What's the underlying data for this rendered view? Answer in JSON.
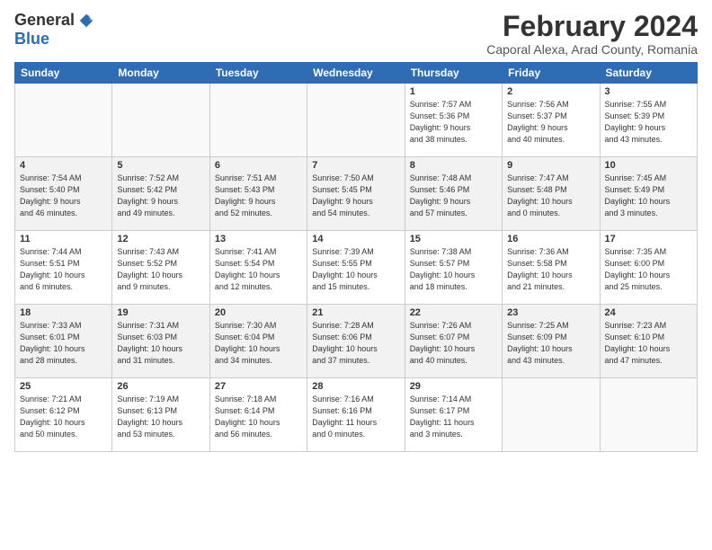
{
  "logo": {
    "general": "General",
    "blue": "Blue"
  },
  "title": "February 2024",
  "subtitle": "Caporal Alexa, Arad County, Romania",
  "headers": [
    "Sunday",
    "Monday",
    "Tuesday",
    "Wednesday",
    "Thursday",
    "Friday",
    "Saturday"
  ],
  "weeks": [
    [
      {
        "day": "",
        "info": ""
      },
      {
        "day": "",
        "info": ""
      },
      {
        "day": "",
        "info": ""
      },
      {
        "day": "",
        "info": ""
      },
      {
        "day": "1",
        "info": "Sunrise: 7:57 AM\nSunset: 5:36 PM\nDaylight: 9 hours\nand 38 minutes."
      },
      {
        "day": "2",
        "info": "Sunrise: 7:56 AM\nSunset: 5:37 PM\nDaylight: 9 hours\nand 40 minutes."
      },
      {
        "day": "3",
        "info": "Sunrise: 7:55 AM\nSunset: 5:39 PM\nDaylight: 9 hours\nand 43 minutes."
      }
    ],
    [
      {
        "day": "4",
        "info": "Sunrise: 7:54 AM\nSunset: 5:40 PM\nDaylight: 9 hours\nand 46 minutes."
      },
      {
        "day": "5",
        "info": "Sunrise: 7:52 AM\nSunset: 5:42 PM\nDaylight: 9 hours\nand 49 minutes."
      },
      {
        "day": "6",
        "info": "Sunrise: 7:51 AM\nSunset: 5:43 PM\nDaylight: 9 hours\nand 52 minutes."
      },
      {
        "day": "7",
        "info": "Sunrise: 7:50 AM\nSunset: 5:45 PM\nDaylight: 9 hours\nand 54 minutes."
      },
      {
        "day": "8",
        "info": "Sunrise: 7:48 AM\nSunset: 5:46 PM\nDaylight: 9 hours\nand 57 minutes."
      },
      {
        "day": "9",
        "info": "Sunrise: 7:47 AM\nSunset: 5:48 PM\nDaylight: 10 hours\nand 0 minutes."
      },
      {
        "day": "10",
        "info": "Sunrise: 7:45 AM\nSunset: 5:49 PM\nDaylight: 10 hours\nand 3 minutes."
      }
    ],
    [
      {
        "day": "11",
        "info": "Sunrise: 7:44 AM\nSunset: 5:51 PM\nDaylight: 10 hours\nand 6 minutes."
      },
      {
        "day": "12",
        "info": "Sunrise: 7:43 AM\nSunset: 5:52 PM\nDaylight: 10 hours\nand 9 minutes."
      },
      {
        "day": "13",
        "info": "Sunrise: 7:41 AM\nSunset: 5:54 PM\nDaylight: 10 hours\nand 12 minutes."
      },
      {
        "day": "14",
        "info": "Sunrise: 7:39 AM\nSunset: 5:55 PM\nDaylight: 10 hours\nand 15 minutes."
      },
      {
        "day": "15",
        "info": "Sunrise: 7:38 AM\nSunset: 5:57 PM\nDaylight: 10 hours\nand 18 minutes."
      },
      {
        "day": "16",
        "info": "Sunrise: 7:36 AM\nSunset: 5:58 PM\nDaylight: 10 hours\nand 21 minutes."
      },
      {
        "day": "17",
        "info": "Sunrise: 7:35 AM\nSunset: 6:00 PM\nDaylight: 10 hours\nand 25 minutes."
      }
    ],
    [
      {
        "day": "18",
        "info": "Sunrise: 7:33 AM\nSunset: 6:01 PM\nDaylight: 10 hours\nand 28 minutes."
      },
      {
        "day": "19",
        "info": "Sunrise: 7:31 AM\nSunset: 6:03 PM\nDaylight: 10 hours\nand 31 minutes."
      },
      {
        "day": "20",
        "info": "Sunrise: 7:30 AM\nSunset: 6:04 PM\nDaylight: 10 hours\nand 34 minutes."
      },
      {
        "day": "21",
        "info": "Sunrise: 7:28 AM\nSunset: 6:06 PM\nDaylight: 10 hours\nand 37 minutes."
      },
      {
        "day": "22",
        "info": "Sunrise: 7:26 AM\nSunset: 6:07 PM\nDaylight: 10 hours\nand 40 minutes."
      },
      {
        "day": "23",
        "info": "Sunrise: 7:25 AM\nSunset: 6:09 PM\nDaylight: 10 hours\nand 43 minutes."
      },
      {
        "day": "24",
        "info": "Sunrise: 7:23 AM\nSunset: 6:10 PM\nDaylight: 10 hours\nand 47 minutes."
      }
    ],
    [
      {
        "day": "25",
        "info": "Sunrise: 7:21 AM\nSunset: 6:12 PM\nDaylight: 10 hours\nand 50 minutes."
      },
      {
        "day": "26",
        "info": "Sunrise: 7:19 AM\nSunset: 6:13 PM\nDaylight: 10 hours\nand 53 minutes."
      },
      {
        "day": "27",
        "info": "Sunrise: 7:18 AM\nSunset: 6:14 PM\nDaylight: 10 hours\nand 56 minutes."
      },
      {
        "day": "28",
        "info": "Sunrise: 7:16 AM\nSunset: 6:16 PM\nDaylight: 11 hours\nand 0 minutes."
      },
      {
        "day": "29",
        "info": "Sunrise: 7:14 AM\nSunset: 6:17 PM\nDaylight: 11 hours\nand 3 minutes."
      },
      {
        "day": "",
        "info": ""
      },
      {
        "day": "",
        "info": ""
      }
    ]
  ]
}
